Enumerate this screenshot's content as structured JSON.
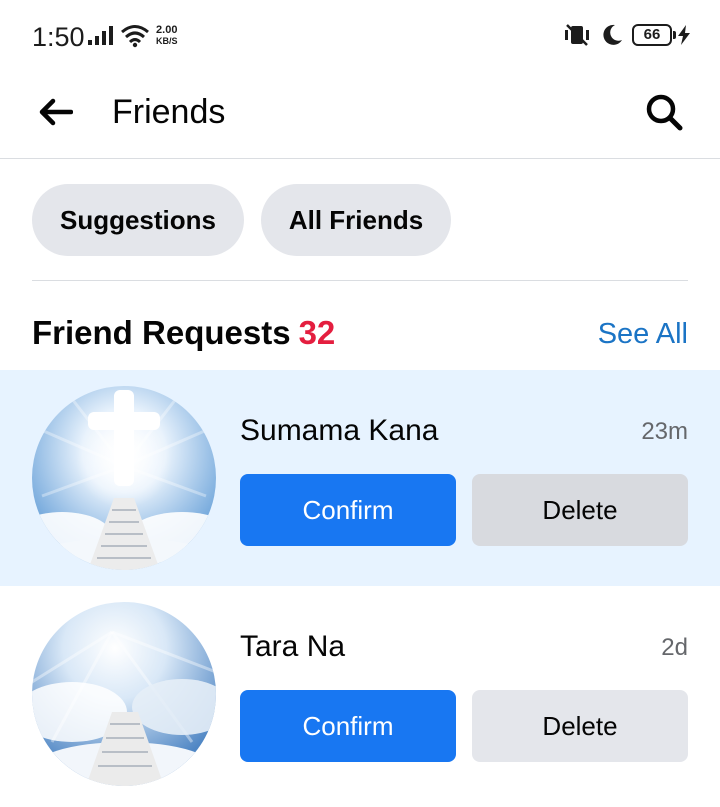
{
  "status_bar": {
    "time": "1:50",
    "net_speed_value": "2.00",
    "net_speed_unit": "KB/S",
    "battery": "66",
    "icons": [
      "signal-icon",
      "wifi-icon",
      "vibrate-off-icon",
      "moon-icon",
      "battery-icon",
      "charging-bolt-icon"
    ]
  },
  "header": {
    "title": "Friends",
    "back_icon": "arrow-left-icon",
    "search_icon": "search-icon"
  },
  "pills": [
    {
      "label": "Suggestions"
    },
    {
      "label": "All Friends"
    }
  ],
  "friend_requests": {
    "title": "Friend Requests",
    "count": "32",
    "see_all": "See All",
    "items": [
      {
        "name": "Sumama Kana",
        "time": "23m",
        "confirm": "Confirm",
        "delete": "Delete",
        "highlighted": true
      },
      {
        "name": "Tara Na",
        "time": "2d",
        "confirm": "Confirm",
        "delete": "Delete",
        "highlighted": false
      }
    ]
  },
  "colors": {
    "accent": "#1877f2",
    "link": "#1b74c5",
    "count_red": "#e41e3f",
    "highlight_bg": "#e7f3ff",
    "pill_bg": "#e4e6eb"
  }
}
